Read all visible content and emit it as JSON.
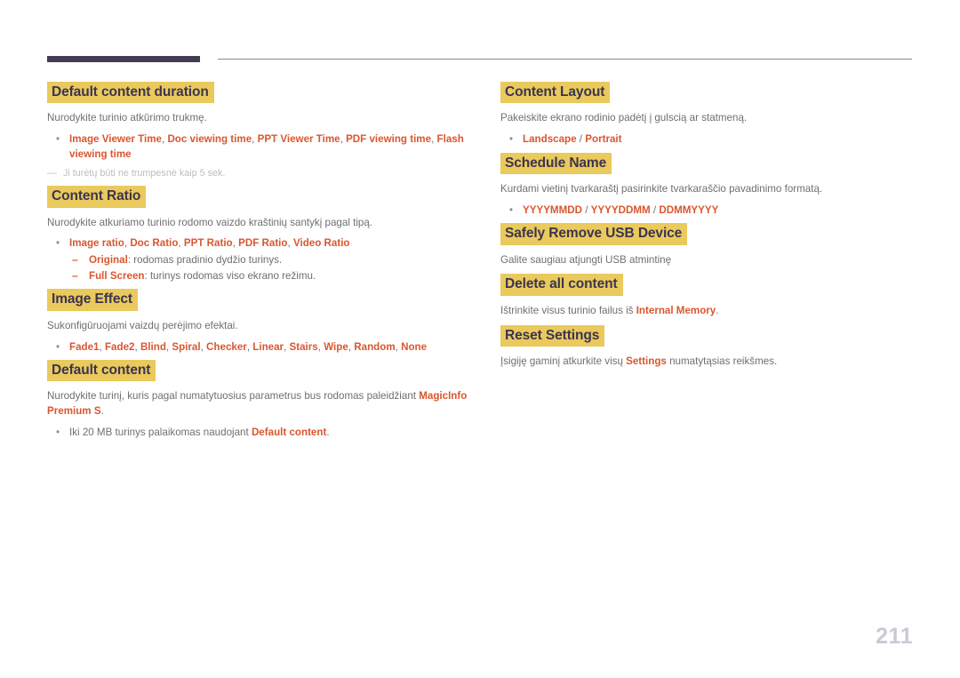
{
  "page": {
    "number": "211",
    "header": {
      "thick_bar_color": "#443c55",
      "thin_rule_color": "#8a8a8a"
    },
    "colors": {
      "heading_highlight": "#eac95d",
      "heading_text": "#3b3450",
      "body_text": "#6f6f6f",
      "emphasis": "#d9572f",
      "note_text": "#bdbdbd",
      "page_number": "#c9cad6"
    }
  },
  "left_column": {
    "sections": [
      {
        "heading": "Default content duration",
        "body": "Nurodykite turinio atkūrimo trukmę.",
        "bullets": [
          {
            "marker": "•",
            "parts": [
              {
                "text": "Image Viewer Time",
                "style": "em"
              },
              {
                "text": ", ",
                "style": "sep"
              },
              {
                "text": "Doc viewing time",
                "style": "em"
              },
              {
                "text": ", ",
                "style": "sep"
              },
              {
                "text": "PPT Viewer Time",
                "style": "em"
              },
              {
                "text": ", ",
                "style": "sep"
              },
              {
                "text": "PDF viewing time",
                "style": "em"
              },
              {
                "text": ", ",
                "style": "sep"
              },
              {
                "text": "Flash viewing time",
                "style": "em"
              }
            ]
          }
        ],
        "note": {
          "dash": "—",
          "text": "Ji turėtų būti ne trumpesnė kaip 5 sek."
        }
      },
      {
        "heading": "Content Ratio",
        "body": "Nurodykite atkuriamo turinio rodomo vaizdo kraštinių santykį pagal tipą.",
        "bullets": [
          {
            "marker": "•",
            "parts": [
              {
                "text": "Image ratio",
                "style": "em"
              },
              {
                "text": ", ",
                "style": "sep"
              },
              {
                "text": "Doc Ratio",
                "style": "em"
              },
              {
                "text": ", ",
                "style": "sep"
              },
              {
                "text": "PPT Ratio",
                "style": "em"
              },
              {
                "text": ", ",
                "style": "sep"
              },
              {
                "text": "PDF Ratio",
                "style": "em"
              },
              {
                "text": ", ",
                "style": "sep"
              },
              {
                "text": "Video Ratio",
                "style": "em"
              }
            ],
            "subbullets": [
              {
                "marker": "–",
                "parts": [
                  {
                    "text": "Original",
                    "style": "em"
                  },
                  {
                    "text": ": rodomas pradinio dydžio turinys.",
                    "style": "sep"
                  }
                ]
              },
              {
                "marker": "–",
                "parts": [
                  {
                    "text": "Full Screen",
                    "style": "em"
                  },
                  {
                    "text": ": turinys rodomas viso ekrano režimu.",
                    "style": "sep"
                  }
                ]
              }
            ]
          }
        ]
      },
      {
        "heading": "Image Effect",
        "body": "Sukonfigūruojami vaizdų perėjimo efektai.",
        "bullets": [
          {
            "marker": "•",
            "parts": [
              {
                "text": "Fade1",
                "style": "em"
              },
              {
                "text": ", ",
                "style": "sep"
              },
              {
                "text": "Fade2",
                "style": "em"
              },
              {
                "text": ", ",
                "style": "sep"
              },
              {
                "text": "Blind",
                "style": "em"
              },
              {
                "text": ", ",
                "style": "sep"
              },
              {
                "text": "Spiral",
                "style": "em"
              },
              {
                "text": ", ",
                "style": "sep"
              },
              {
                "text": "Checker",
                "style": "em"
              },
              {
                "text": ", ",
                "style": "sep"
              },
              {
                "text": "Linear",
                "style": "em"
              },
              {
                "text": ", ",
                "style": "sep"
              },
              {
                "text": "Stairs",
                "style": "em"
              },
              {
                "text": ", ",
                "style": "sep"
              },
              {
                "text": "Wipe",
                "style": "em"
              },
              {
                "text": ", ",
                "style": "sep"
              },
              {
                "text": "Random",
                "style": "em"
              },
              {
                "text": ", ",
                "style": "sep"
              },
              {
                "text": "None",
                "style": "em"
              }
            ]
          }
        ]
      },
      {
        "heading": "Default content",
        "body_parts": [
          {
            "text": "Nurodykite turinį, kuris pagal numatytuosius parametrus bus rodomas paleidžiant ",
            "style": "sep"
          },
          {
            "text": "MagicInfo Premium S",
            "style": "em"
          },
          {
            "text": ".",
            "style": "sep"
          }
        ],
        "bullets": [
          {
            "marker": "•",
            "parts": [
              {
                "text": "Iki 20 MB turinys palaikomas naudojant ",
                "style": "sep"
              },
              {
                "text": "Default content",
                "style": "em"
              },
              {
                "text": ".",
                "style": "sep"
              }
            ]
          }
        ]
      }
    ]
  },
  "right_column": {
    "sections": [
      {
        "heading": "Content Layout",
        "body": "Pakeiskite ekrano rodinio padėtį į gulscią ar statmeną.",
        "bullets": [
          {
            "marker": "•",
            "parts": [
              {
                "text": "Landscape",
                "style": "em"
              },
              {
                "text": " / ",
                "style": "sep"
              },
              {
                "text": "Portrait",
                "style": "em"
              }
            ]
          }
        ]
      },
      {
        "heading": "Schedule Name",
        "body": "Kurdami vietinį tvarkaraštį pasirinkite tvarkaraščio pavadinimo formatą.",
        "bullets": [
          {
            "marker": "•",
            "parts": [
              {
                "text": "YYYYMMDD",
                "style": "em"
              },
              {
                "text": " / ",
                "style": "sep"
              },
              {
                "text": "YYYYDDMM",
                "style": "em"
              },
              {
                "text": " / ",
                "style": "sep"
              },
              {
                "text": "DDMMYYYY",
                "style": "em"
              }
            ]
          }
        ]
      },
      {
        "heading": "Safely Remove USB Device",
        "body": "Galite saugiau atjungti USB atmintinę"
      },
      {
        "heading": "Delete all content",
        "body_parts": [
          {
            "text": "Ištrinkite visus turinio failus iš ",
            "style": "sep"
          },
          {
            "text": "Internal Memory",
            "style": "em"
          },
          {
            "text": ".",
            "style": "sep"
          }
        ]
      },
      {
        "heading": "Reset Settings",
        "body_parts": [
          {
            "text": "Įsigiję gaminį atkurkite visų ",
            "style": "sep"
          },
          {
            "text": "Settings",
            "style": "em"
          },
          {
            "text": " numatytąsias reikšmes.",
            "style": "sep"
          }
        ]
      }
    ]
  }
}
